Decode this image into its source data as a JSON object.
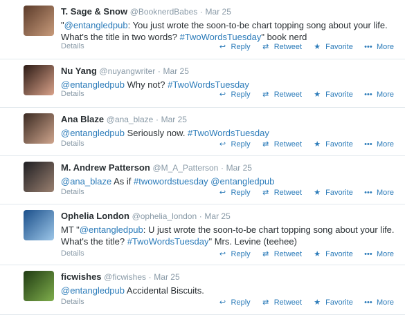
{
  "labels": {
    "details": "Details",
    "reply": "Reply",
    "retweet": "Retweet",
    "favorite": "Favorite",
    "more": "More"
  },
  "tweets": [
    {
      "name": "T. Sage & Snow",
      "handle": "@BooknerdBabes",
      "time": "Mar 25",
      "segments": [
        {
          "t": "\"",
          "link": false
        },
        {
          "t": "@entangledpub",
          "link": true
        },
        {
          "t": ": You just wrote the soon-to-be chart topping song about your life. What's the title in two words? ",
          "link": false
        },
        {
          "t": "#TwoWordsTuesday",
          "link": true
        },
        {
          "t": "\" book nerd",
          "link": false
        }
      ],
      "avatar_colors": [
        "#5b3b2a",
        "#c89b7b"
      ]
    },
    {
      "name": "Nu Yang",
      "handle": "@nuyangwriter",
      "time": "Mar 25",
      "segments": [
        {
          "t": "@entangledpub",
          "link": true
        },
        {
          "t": " Why not? ",
          "link": false
        },
        {
          "t": "#TwoWordsTuesday",
          "link": true
        }
      ],
      "avatar_colors": [
        "#2b1a14",
        "#d9a28a"
      ]
    },
    {
      "name": "Ana Blaze",
      "handle": "@ana_blaze",
      "time": "Mar 25",
      "segments": [
        {
          "t": "@entangledpub",
          "link": true
        },
        {
          "t": "  Seriously now. ",
          "link": false
        },
        {
          "t": "#TwoWordsTuesday",
          "link": true
        }
      ],
      "avatar_colors": [
        "#3a2a22",
        "#cfa58d"
      ]
    },
    {
      "name": "M. Andrew Patterson",
      "handle": "@M_A_Patterson",
      "time": "Mar 25",
      "segments": [
        {
          "t": "@ana_blaze",
          "link": true
        },
        {
          "t": " As if ",
          "link": false
        },
        {
          "t": "#twowordstuesday",
          "link": true
        },
        {
          "t": " ",
          "link": false
        },
        {
          "t": "@entangledpub",
          "link": true
        }
      ],
      "avatar_colors": [
        "#1e1e22",
        "#9a8070"
      ]
    },
    {
      "name": "Ophelia London",
      "handle": "@ophelia_london",
      "time": "Mar 25",
      "segments": [
        {
          "t": "MT \"",
          "link": false
        },
        {
          "t": "@entangledpub",
          "link": true
        },
        {
          "t": ": U just wrote the soon-to-be chart topping song about your life. What's the title? ",
          "link": false
        },
        {
          "t": "#TwoWordsTuesday",
          "link": true
        },
        {
          "t": "\" Mrs. Levine (teehee)",
          "link": false
        }
      ],
      "avatar_colors": [
        "#1b4f8a",
        "#9cc6e8"
      ]
    },
    {
      "name": "ficwishes",
      "handle": "@ficwishes",
      "time": "Mar 25",
      "segments": [
        {
          "t": "@entangledpub",
          "link": true
        },
        {
          "t": " Accidental Biscuits.",
          "link": false
        }
      ],
      "avatar_colors": [
        "#1f3a12",
        "#7fae4c"
      ]
    }
  ]
}
